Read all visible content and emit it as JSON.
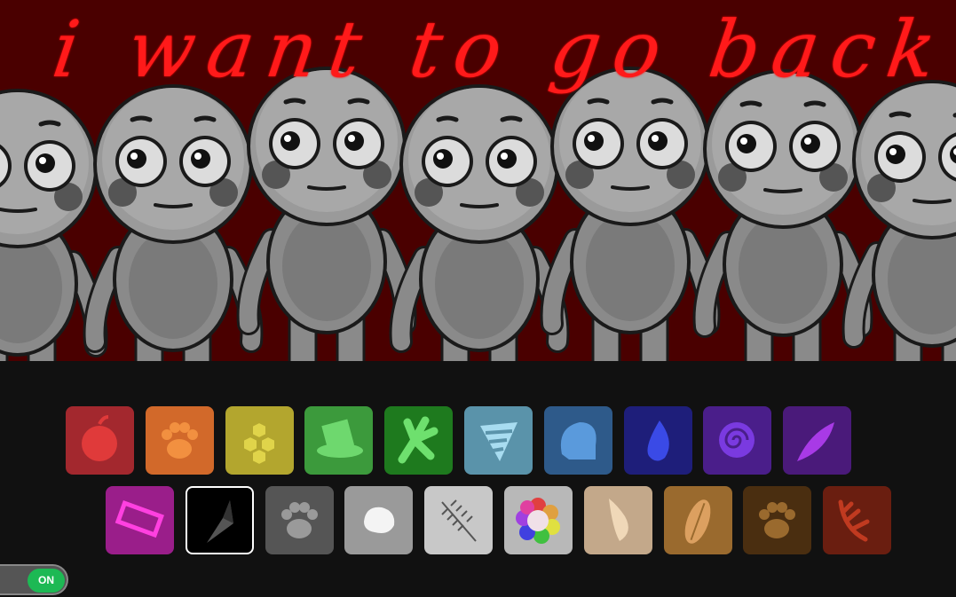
{
  "scene": {
    "title_text": "i want to go back",
    "character_count": 7,
    "background_color": "#4a0000",
    "title_color": "#ff1a1a",
    "body_color": "#8a8a8a"
  },
  "palette": {
    "row1": [
      {
        "icon": "apple-icon",
        "color": "#a3282e"
      },
      {
        "icon": "paw-icon",
        "color": "#d2692a"
      },
      {
        "icon": "honeycomb-icon",
        "color": "#b3a62e"
      },
      {
        "icon": "top-hat-icon",
        "color": "#3c9a3c"
      },
      {
        "icon": "frog-hand-icon",
        "color": "#1e7a1e"
      },
      {
        "icon": "striped-flag-icon",
        "color": "#5a93aa"
      },
      {
        "icon": "blue-blob-icon",
        "color": "#2e5a8a"
      },
      {
        "icon": "water-drops-icon",
        "color": "#1e1e7a"
      },
      {
        "icon": "spiral-icon",
        "color": "#4a1e8a"
      },
      {
        "icon": "purple-leaf-icon",
        "color": "#4a1a7a"
      }
    ],
    "row2": [
      {
        "icon": "pink-tag-icon",
        "color": "#9a1e8a"
      },
      {
        "icon": "crystal-shard-icon",
        "color": "#000000",
        "selected": true
      },
      {
        "icon": "grey-paw-icon",
        "color": "#555555"
      },
      {
        "icon": "white-stone-icon",
        "color": "#9a9a9a"
      },
      {
        "icon": "fern-leaf-icon",
        "color": "#c8c8c8"
      },
      {
        "icon": "rainbow-flower-icon",
        "color": "#b8b8b8"
      },
      {
        "icon": "horn-icon",
        "color": "#c3a88a"
      },
      {
        "icon": "bread-icon",
        "color": "#9a6a2e"
      },
      {
        "icon": "brown-paw-icon",
        "color": "#4a2e10"
      },
      {
        "icon": "antler-icon",
        "color": "#6a1e10"
      }
    ]
  },
  "toggle": {
    "label": "ON",
    "state": "on"
  }
}
